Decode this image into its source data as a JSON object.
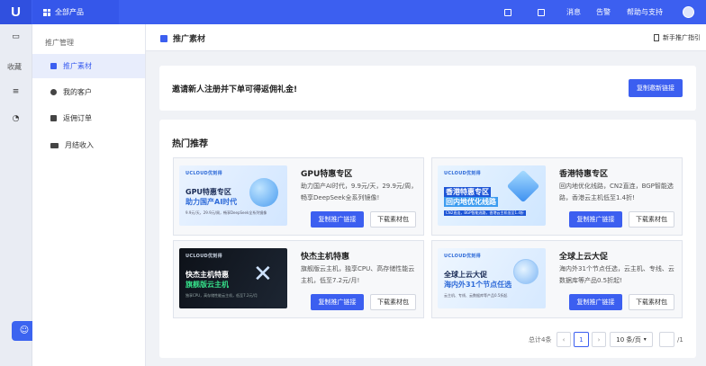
{
  "topbar": {
    "logo": "U",
    "all_products": "全部产品",
    "messages": "消息",
    "alerts": "告警",
    "help": "帮助与支持"
  },
  "rail": {
    "favorites": "收藏"
  },
  "sidebar": {
    "section_title": "推广管理",
    "items": [
      {
        "label": "推广素材",
        "icon": "image-icon",
        "active": true
      },
      {
        "label": "我的客户",
        "icon": "user-icon",
        "active": false
      },
      {
        "label": "返佣订单",
        "icon": "order-icon",
        "active": false
      },
      {
        "label": "月结收入",
        "icon": "wallet-icon",
        "active": false
      }
    ]
  },
  "header": {
    "title": "推广素材",
    "guide": "新手推广指引"
  },
  "banner": {
    "text": "邀请新人注册并下单可得返佣礼金!",
    "button": "复制邀新链接"
  },
  "section": {
    "title": "热门推荐"
  },
  "cards": [
    {
      "title": "GPU特惠专区",
      "desc": "助力国产AI时代，9.9元/天，29.9元/周，畅享DeepSeek全系列镜像!",
      "thumb": {
        "brand": "UCLOUD优刻得",
        "line1": "GPU特惠专区",
        "line2": "助力国产AI时代",
        "line3": "9.9元/天，29.9元/周，畅享DeepSeek全系列镜像"
      },
      "copy": "复制推广链接",
      "download": "下载素材包"
    },
    {
      "title": "香港特惠专区",
      "desc": "回内地优化线路，CN2直连，BGP智能选路，香港云主机低至1.4折!",
      "thumb": {
        "brand": "UCLOUD优刻得",
        "line1": "香港特惠专区",
        "line2": "回内地优化线路",
        "line3": "CN2直连，BGP智能选路，香港云主机低至1.4折"
      },
      "copy": "复制推广链接",
      "download": "下载素材包"
    },
    {
      "title": "快杰主机特惠",
      "desc": "旗舰版云主机，独享CPU、高存储性能云主机，低至7.2元/月!",
      "thumb": {
        "brand": "UCLOUD优刻得",
        "line1": "快杰主机特惠",
        "line2": "旗舰版云主机",
        "line3": "独享CPU，高存储性能云主机，低至7.2元/月"
      },
      "copy": "复制推广链接",
      "download": "下载素材包"
    },
    {
      "title": "全球上云大促",
      "desc": "海内外31个节点任选，云主机、专线、云数据库等产品0.5折起!",
      "thumb": {
        "brand": "UCLOUD优刻得",
        "line1": "全球上云大促",
        "line2": "海内外31个节点任选",
        "line3": "云主机、专线、云数据库等产品0.5折起"
      },
      "copy": "复制推广链接",
      "download": "下载素材包"
    }
  ],
  "pagination": {
    "total": "总计4条",
    "prev": "‹",
    "current": "1",
    "next": "›",
    "page_size": "10 条/页",
    "jump_value": "",
    "of_pages": "/1"
  },
  "colors": {
    "primary": "#3c5ff0",
    "topbar": "#3c5ff0"
  }
}
